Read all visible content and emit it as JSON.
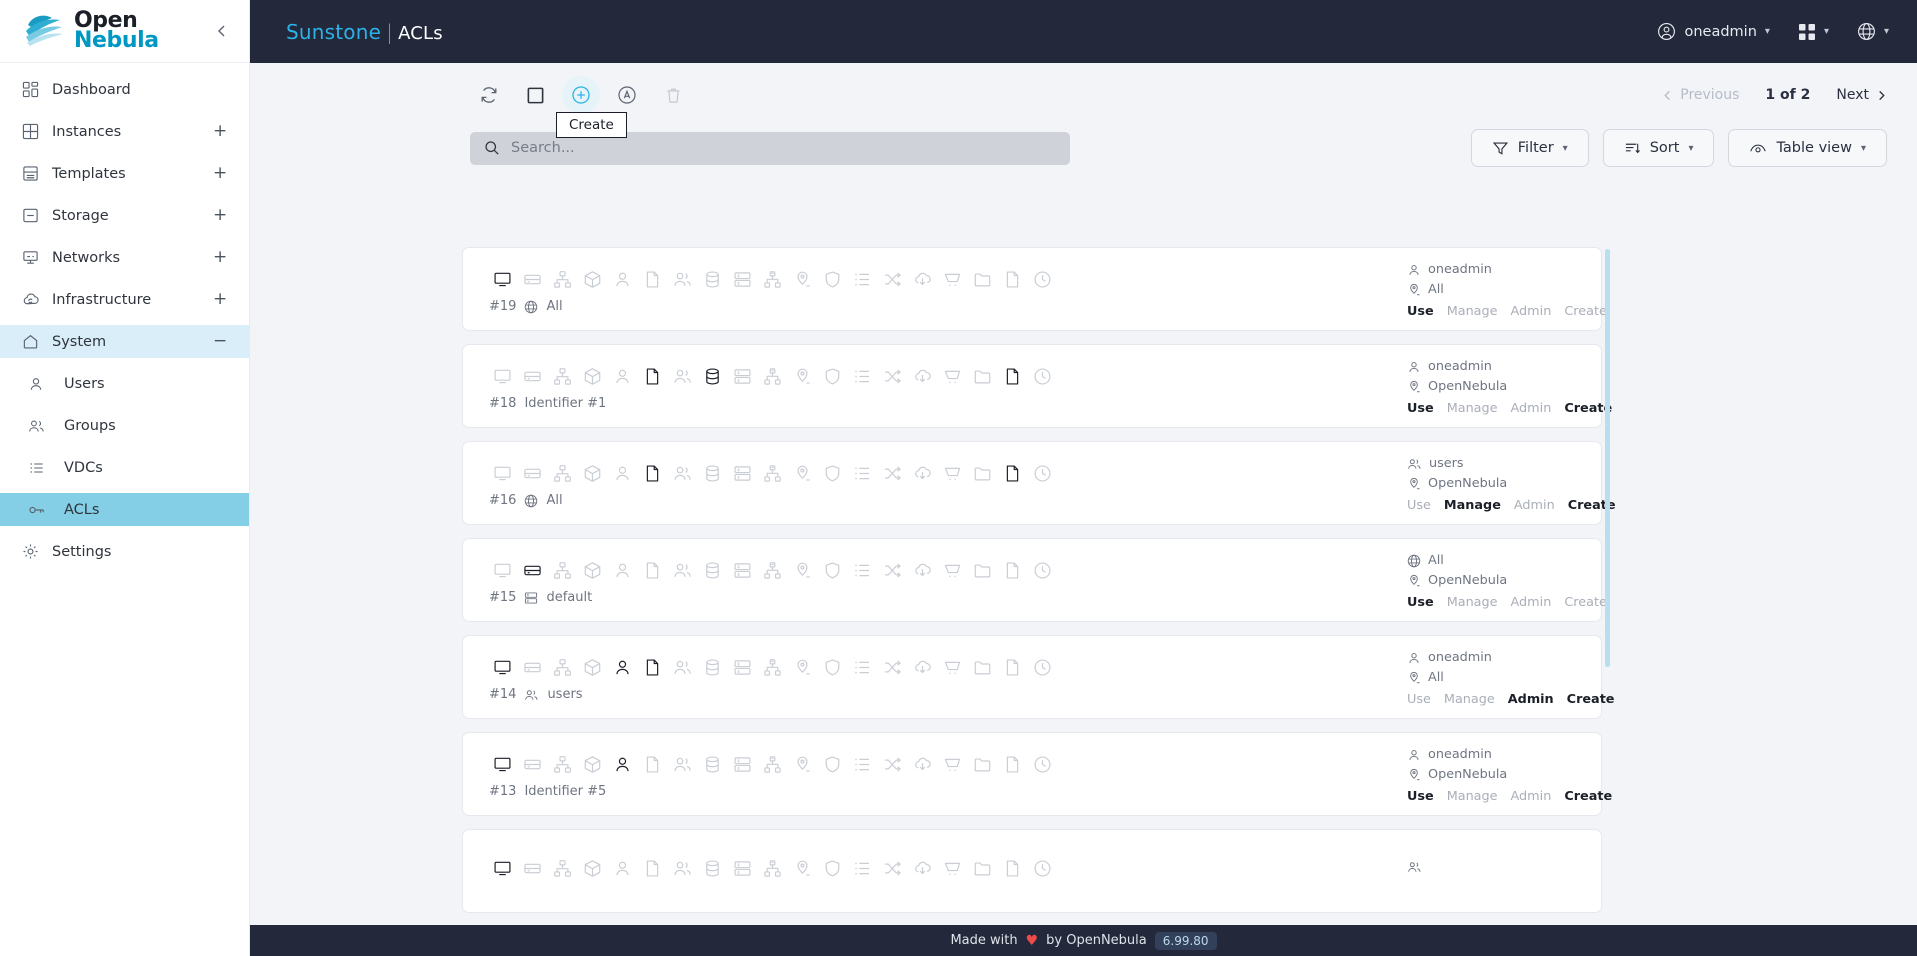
{
  "sidebar": {
    "logo": {
      "line1": "Open",
      "line2": "Nebula",
      "icon": "opennebula-logo"
    },
    "collapse_icon": "chevron-left-icon",
    "items": [
      {
        "label": "Dashboard",
        "icon": "dashboard-icon",
        "expand": "",
        "state": "normal"
      },
      {
        "label": "Instances",
        "icon": "instances-grid-icon",
        "expand": "+",
        "state": "normal"
      },
      {
        "label": "Templates",
        "icon": "templates-icon",
        "expand": "+",
        "state": "normal"
      },
      {
        "label": "Storage",
        "icon": "storage-icon",
        "expand": "+",
        "state": "normal"
      },
      {
        "label": "Networks",
        "icon": "networks-icon",
        "expand": "+",
        "state": "normal"
      },
      {
        "label": "Infrastructure",
        "icon": "infrastructure-cloud-icon",
        "expand": "+",
        "state": "normal"
      },
      {
        "label": "System",
        "icon": "system-home-icon",
        "expand": "−",
        "state": "active-parent"
      }
    ],
    "sub_items": [
      {
        "label": "Users",
        "icon": "user-icon",
        "state": "normal"
      },
      {
        "label": "Groups",
        "icon": "groups-icon",
        "state": "normal"
      },
      {
        "label": "VDCs",
        "icon": "list-icon",
        "state": "normal"
      },
      {
        "label": "ACLs",
        "icon": "key-icon",
        "state": "active"
      }
    ],
    "settings": {
      "label": "Settings",
      "icon": "gear-icon",
      "state": "normal"
    }
  },
  "topbar": {
    "brand": "Sunstone",
    "separator": "|",
    "page": "ACLs",
    "user": {
      "label": "oneadmin",
      "icon": "user-circle-icon",
      "chevron": "chevron-down-icon"
    },
    "apps": {
      "icon": "apps-grid-icon",
      "chevron": "chevron-down-icon"
    },
    "language": {
      "icon": "globe-icon",
      "chevron": "chevron-down-icon"
    }
  },
  "toolbar": {
    "refresh": {
      "label": "Refresh",
      "icon": "refresh-icon"
    },
    "select_all": {
      "label": "Select all",
      "icon": "checkbox-empty-icon"
    },
    "create": {
      "label": "Create",
      "icon": "plus-circle-icon",
      "highlighted": true
    },
    "addon": {
      "label": "Add",
      "icon": "circle-a-icon"
    },
    "delete": {
      "label": "Delete",
      "icon": "trash-icon",
      "disabled": true
    },
    "tooltip_text": "Create"
  },
  "pagination": {
    "previous": "Previous",
    "previous_icon": "chevron-left-icon",
    "count": "1 of 2",
    "next": "Next",
    "next_icon": "chevron-right-icon"
  },
  "search": {
    "placeholder": "Search...",
    "value": "",
    "icon": "search-icon"
  },
  "controls": [
    {
      "label": "Filter",
      "icon": "funnel-icon",
      "chevron": "chevron-down-icon"
    },
    {
      "label": "Sort",
      "icon": "sort-icon",
      "chevron": "chevron-down-icon"
    },
    {
      "label": "Table view",
      "icon": "eye-icon",
      "chevron": "chevron-down-icon"
    }
  ],
  "resource_icon_names": [
    "vm-monitor-icon",
    "image-drive-icon",
    "virtual-network-icon",
    "template-box-icon",
    "user-icon",
    "document-icon",
    "group-icon",
    "datastore-icon",
    "cluster-icon",
    "host-icon",
    "zone-pin-icon",
    "security-group-shield-icon",
    "vdc-list-icon",
    "vrouter-shuffle-icon",
    "marketplace-cloud-icon",
    "marketplace-app-cart-icon",
    "vm-group-folder-icon",
    "backupjob-file-icon",
    "scheduled-action-clock-icon"
  ],
  "permission_labels": [
    "Use",
    "Manage",
    "Admin",
    "Create"
  ],
  "acl_rules": [
    {
      "id": "#19",
      "applies_icon": "globe-icon",
      "applies_to": "All",
      "active_resources": [
        0
      ],
      "user": "oneadmin",
      "user_icon": "user-icon",
      "zone": "All",
      "zone_icon": "zone-pin-icon",
      "permissions": [
        true,
        false,
        false,
        false
      ]
    },
    {
      "id": "#18",
      "applies_icon": "",
      "applies_to": "Identifier #1",
      "active_resources": [
        5,
        7,
        17
      ],
      "user": "oneadmin",
      "user_icon": "user-icon",
      "zone": "OpenNebula",
      "zone_icon": "zone-pin-icon",
      "permissions": [
        true,
        false,
        false,
        true
      ]
    },
    {
      "id": "#16",
      "applies_icon": "globe-icon",
      "applies_to": "All",
      "active_resources": [
        5,
        17
      ],
      "user": "users",
      "user_icon": "group-icon",
      "zone": "OpenNebula",
      "zone_icon": "zone-pin-icon",
      "permissions": [
        false,
        true,
        false,
        true
      ]
    },
    {
      "id": "#15",
      "applies_icon": "cluster-icon",
      "applies_to": "default",
      "active_resources": [
        1
      ],
      "user": "All",
      "user_icon": "globe-icon",
      "zone": "OpenNebula",
      "zone_icon": "zone-pin-icon",
      "permissions": [
        true,
        false,
        false,
        false
      ]
    },
    {
      "id": "#14",
      "applies_icon": "group-icon",
      "applies_to": "users",
      "active_resources": [
        0,
        4,
        5
      ],
      "user": "oneadmin",
      "user_icon": "user-icon",
      "zone": "All",
      "zone_icon": "zone-pin-icon",
      "permissions": [
        false,
        false,
        true,
        true
      ]
    },
    {
      "id": "#13",
      "applies_icon": "",
      "applies_to": "Identifier #5",
      "active_resources": [
        0,
        4
      ],
      "user": "oneadmin",
      "user_icon": "user-icon",
      "zone": "OpenNebula",
      "zone_icon": "zone-pin-icon",
      "permissions": [
        true,
        false,
        false,
        true
      ]
    },
    {
      "id": "",
      "applies_icon": "",
      "applies_to": "",
      "active_resources": [
        0
      ],
      "user": "",
      "user_icon": "group-icon",
      "zone": "",
      "zone_icon": "",
      "permissions": [
        false,
        false,
        false,
        false
      ]
    }
  ],
  "footer": {
    "made_with": "Made with",
    "heart": "♥",
    "by": "by OpenNebula",
    "version": "6.99.80"
  }
}
